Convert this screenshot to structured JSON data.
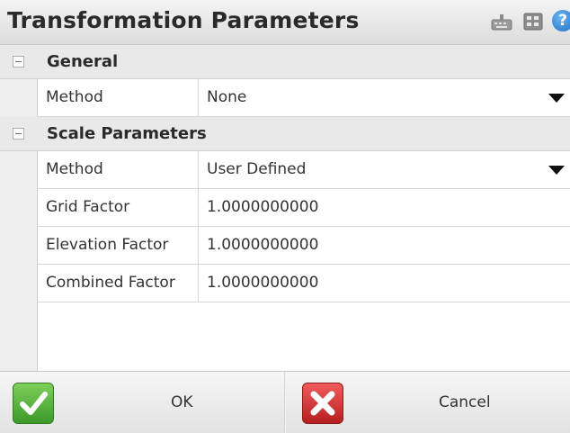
{
  "window": {
    "title": "Transformation Parameters",
    "icons": [
      "keyboard-icon",
      "calculator-icon",
      "help-icon"
    ],
    "help_glyph": "?"
  },
  "sections": [
    {
      "label": "General",
      "properties": [
        {
          "name": "Method",
          "value": "None",
          "type": "dropdown"
        }
      ]
    },
    {
      "label": "Scale Parameters",
      "properties": [
        {
          "name": "Method",
          "value": "User Defined",
          "type": "dropdown"
        },
        {
          "name": "Grid Factor",
          "value": "1.0000000000",
          "type": "text"
        },
        {
          "name": "Elevation Factor",
          "value": "1.0000000000",
          "type": "text"
        },
        {
          "name": "Combined Factor",
          "value": "1.0000000000",
          "type": "text"
        }
      ]
    }
  ],
  "buttons": {
    "ok_label": "OK",
    "cancel_label": "Cancel"
  },
  "colors": {
    "ok_green": "#3b9a2a",
    "cancel_red": "#b51f1f",
    "help_blue": "#1d6ec8"
  }
}
